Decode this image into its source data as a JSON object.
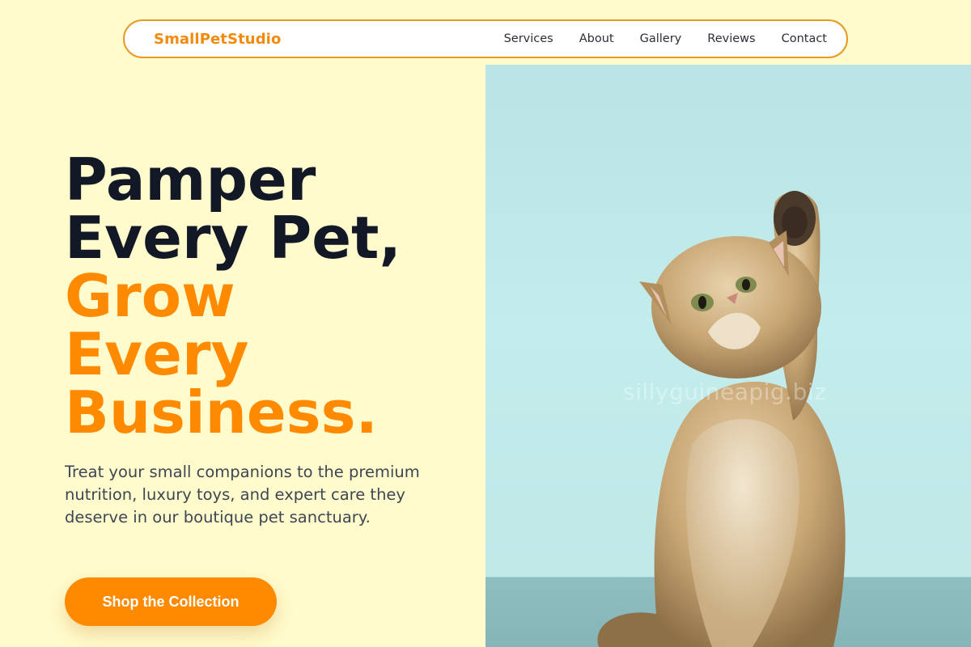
{
  "nav": {
    "brand": "SmallPetStudio",
    "links": [
      "Services",
      "About",
      "Gallery",
      "Reviews",
      "Contact"
    ]
  },
  "hero": {
    "title_lines": [
      "Pamper",
      "Every Pet,"
    ],
    "title_accent_lines": [
      "Grow",
      "Every",
      "Business."
    ],
    "description": "Treat your small companions to the premium nutrition, luxury toys, and expert care they deserve in our boutique pet sanctuary.",
    "cta_label": "Shop the Collection"
  },
  "image": {
    "watermark": "sillyguineapig.biz"
  },
  "colors": {
    "background": "#fffbcc",
    "accent": "#ff8a00",
    "heading": "#121826",
    "nav_border": "#e69a24"
  }
}
